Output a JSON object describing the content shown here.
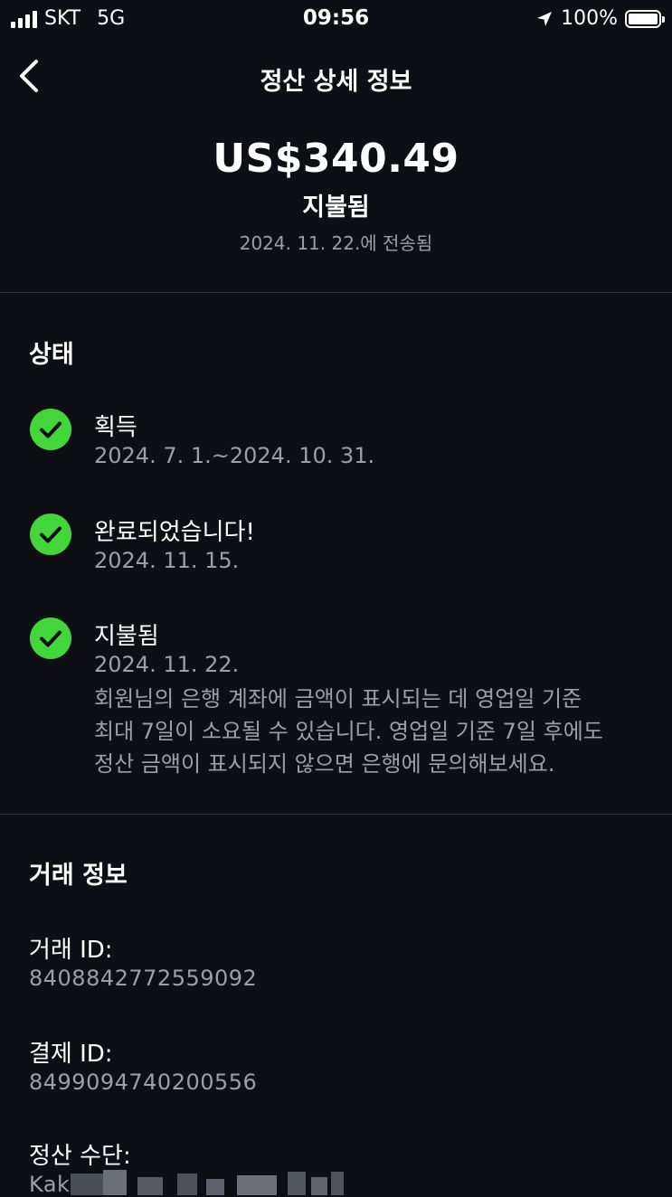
{
  "status_bar": {
    "carrier": "SKT",
    "network": "5G",
    "time": "09:56",
    "battery": "100%",
    "battery_level": 1.0
  },
  "nav": {
    "title": "정산 상세 정보",
    "back_icon": "chevron-left-icon"
  },
  "summary": {
    "amount": "US$340.49",
    "status": "지불됨",
    "sent_date": "2024. 11. 22.에 전송됨"
  },
  "status_section": {
    "title": "상태",
    "steps": [
      {
        "title": "획득",
        "date": "2024. 7. 1.~2024. 10. 31."
      },
      {
        "title": "완료되었습니다!",
        "date": "2024. 11. 15."
      },
      {
        "title": "지불됨",
        "date": "2024. 11. 22.",
        "note_lines": [
          "회원님의 은행 계좌에 금액이 표시되는 데 영업일 기준",
          "최대 7일이 소요될 수 있습니다. 영업일 기준 7일 후에도",
          "정산 금액이 표시되지 않으면 은행에 문의해보세요."
        ]
      }
    ]
  },
  "transaction_section": {
    "title": "거래 정보",
    "fields": [
      {
        "label": "거래 ID:",
        "value": "8408842772559092"
      },
      {
        "label": "결제 ID:",
        "value": "8499094740200556"
      },
      {
        "label": "정산 수단:",
        "value": "Kak"
      }
    ]
  },
  "colors": {
    "background": "#0d0f14",
    "check_green": "#43d63a",
    "secondary_text": "#9aa0a8",
    "divider": "#2e323a"
  }
}
